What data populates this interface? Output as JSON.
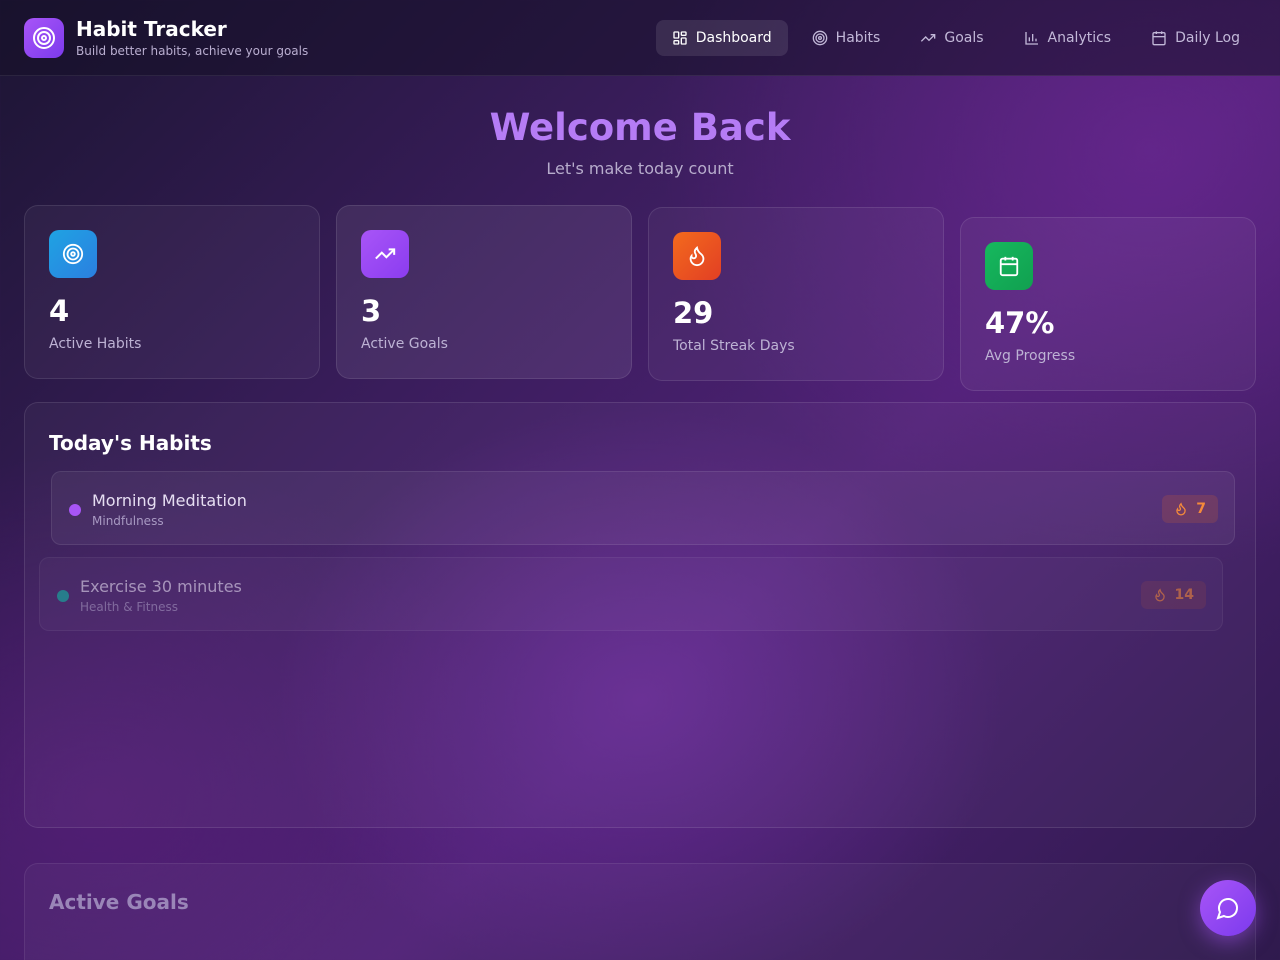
{
  "app": {
    "title": "Habit Tracker",
    "subtitle": "Build better habits, achieve your goals",
    "logo_icon": "target-icon"
  },
  "nav": [
    {
      "label": "Dashboard",
      "icon": "grid-icon",
      "active": true
    },
    {
      "label": "Habits",
      "icon": "target-icon",
      "active": false
    },
    {
      "label": "Goals",
      "icon": "trending-up-icon",
      "active": false
    },
    {
      "label": "Analytics",
      "icon": "bar-chart-icon",
      "active": false
    },
    {
      "label": "Daily Log",
      "icon": "calendar-icon",
      "active": false
    }
  ],
  "welcome": {
    "title": "Welcome Back",
    "subtitle": "Let's make today count"
  },
  "stats": [
    {
      "value": "4",
      "label": "Active Habits",
      "icon": "target-icon",
      "color": "#1fa3e3"
    },
    {
      "value": "3",
      "label": "Active Goals",
      "icon": "trending-up-icon",
      "color": "#a855f7"
    },
    {
      "value": "29",
      "label": "Total Streak Days",
      "icon": "flame-icon",
      "color": "#ef4f1e"
    },
    {
      "value": "47%",
      "label": "Avg Progress",
      "icon": "calendar-icon",
      "color": "#14b15a"
    }
  ],
  "todays_habits": {
    "title": "Today's Habits",
    "items": [
      {
        "name": "Morning Meditation",
        "category": "Mindfulness",
        "streak": "7",
        "dot_color": "#a855f7"
      },
      {
        "name": "Exercise 30 minutes",
        "category": "Health & Fitness",
        "streak": "14",
        "dot_color": "#14b8a6"
      }
    ]
  },
  "goals": {
    "title": "Active Goals"
  },
  "chat_button": {
    "icon": "chat-bubble-icon"
  }
}
